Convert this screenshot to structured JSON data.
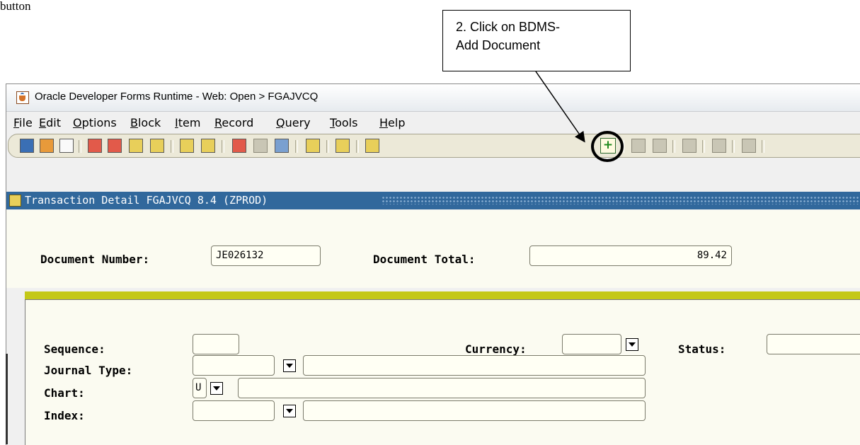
{
  "document_fragment": {
    "text": "button"
  },
  "callout": {
    "line1": "2.  Click on BDMS-",
    "line2": "Add Document"
  },
  "window": {
    "title": "Oracle Developer Forms Runtime - Web:  Open > FGAJVCQ"
  },
  "menu": {
    "items": [
      {
        "accel": "F",
        "rest": "ile"
      },
      {
        "accel": "E",
        "rest": "dit"
      },
      {
        "accel": "O",
        "rest": "ptions"
      },
      {
        "accel": "B",
        "rest": "lock"
      },
      {
        "accel": "I",
        "rest": "tem"
      },
      {
        "accel": "R",
        "rest": "ecord"
      },
      {
        "accel": "Q",
        "rest": "uery"
      },
      {
        "accel": "T",
        "rest": "ools"
      },
      {
        "accel": "H",
        "rest": "elp"
      }
    ]
  },
  "toolbar": {
    "add_document_glyph": "+"
  },
  "form": {
    "title": "Transaction Detail  FGAJVCQ  8.4  (ZPROD)"
  },
  "key_block": {
    "document_number_label": "Document Number:",
    "document_number_value": "JE026132",
    "document_total_label": "Document Total:",
    "document_total_value": "89.42"
  },
  "main_block": {
    "sequence_label": "Sequence:",
    "sequence_value": "",
    "currency_label": "Currency:",
    "currency_value": "",
    "status_label": "Status:",
    "status_value": "",
    "journal_type_label": "Journal Type:",
    "journal_type_value": "",
    "journal_type_desc": "",
    "chart_label": "Chart:",
    "chart_value": "U",
    "chart_desc": "",
    "index_label": "Index:",
    "index_value": "",
    "index_desc": ""
  }
}
